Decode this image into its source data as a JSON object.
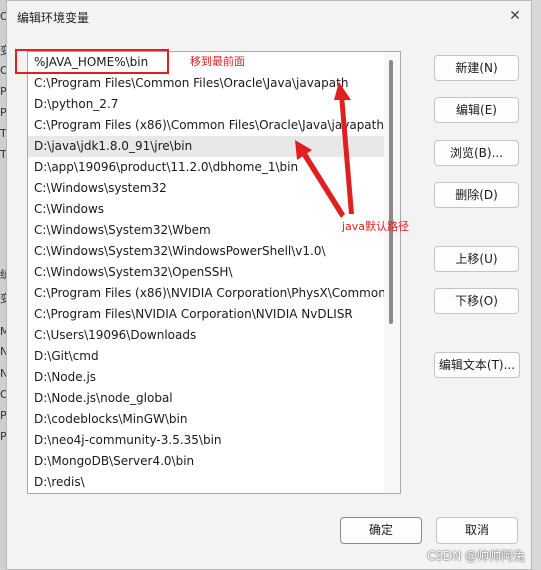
{
  "window": {
    "title": "编辑环境变量",
    "close_glyph": "✕"
  },
  "background_fragments": [
    "Os",
    "变",
    "Ou",
    "Pa",
    "Py",
    "TE",
    "TN",
    "统",
    "变",
    "M",
    "N",
    "N",
    "O",
    "Pa",
    "PA"
  ],
  "path_list": {
    "items": [
      "%JAVA_HOME%\\bin",
      "C:\\Program Files\\Common Files\\Oracle\\Java\\javapath",
      "D:\\python_2.7",
      "C:\\Program Files (x86)\\Common Files\\Oracle\\Java\\javapath",
      "D:\\java\\jdk1.8.0_91\\jre\\bin",
      "D:\\app\\19096\\product\\11.2.0\\dbhome_1\\bin",
      "C:\\Windows\\system32",
      "C:\\Windows",
      "C:\\Windows\\System32\\Wbem",
      "C:\\Windows\\System32\\WindowsPowerShell\\v1.0\\",
      "C:\\Windows\\System32\\OpenSSH\\",
      "C:\\Program Files (x86)\\NVIDIA Corporation\\PhysX\\Common",
      "C:\\Program Files\\NVIDIA Corporation\\NVIDIA NvDLISR",
      "C:\\Users\\19096\\Downloads",
      "D:\\Git\\cmd",
      "D:\\Node.js",
      "D:\\Node.js\\node_global",
      "D:\\codeblocks\\MinGW\\bin",
      "D:\\neo4j-community-3.5.35\\bin",
      "D:\\MongoDB\\Server4.0\\bin",
      "D:\\redis\\"
    ],
    "selected_item": "D:\\java\\jdk1.8.0_91\\jre\\bin"
  },
  "buttons": {
    "new": "新建(N)",
    "edit": "编辑(E)",
    "browse": "浏览(B)...",
    "delete": "删除(D)",
    "move_up": "上移(U)",
    "move_down": "下移(O)",
    "edit_text": "编辑文本(T)...",
    "ok": "确定",
    "cancel": "取消"
  },
  "annotations": {
    "move_to_top": "移到最前面",
    "java_default_path": "java默认路径",
    "color": "#e02020"
  },
  "watermark": "CSDN @帅帅阿兔"
}
